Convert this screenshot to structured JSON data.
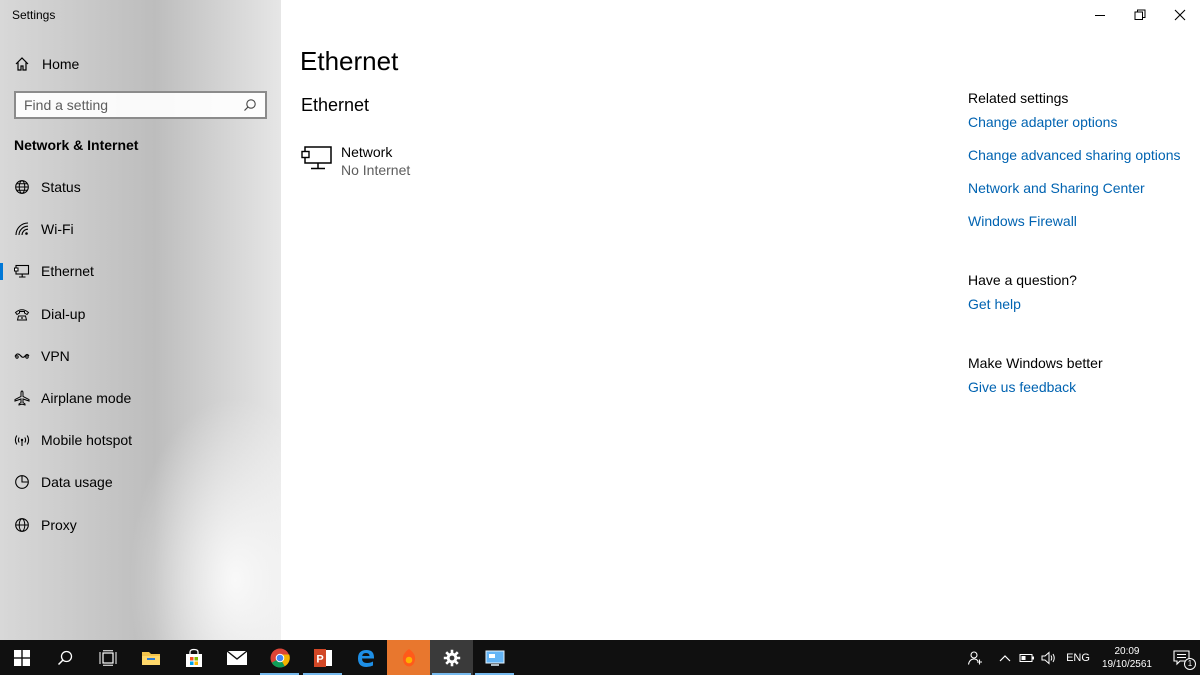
{
  "window": {
    "title": "Settings",
    "controls": [
      "minimize-icon",
      "restore-icon",
      "close-icon"
    ]
  },
  "sidebar": {
    "home_label": "Home",
    "search_placeholder": "Find a setting",
    "section_title": "Network & Internet",
    "items": [
      {
        "label": "Status",
        "icon": "status-globe-icon",
        "active": false
      },
      {
        "label": "Wi-Fi",
        "icon": "wifi-icon",
        "active": false
      },
      {
        "label": "Ethernet",
        "icon": "ethernet-icon",
        "active": true
      },
      {
        "label": "Dial-up",
        "icon": "dialup-icon",
        "active": false
      },
      {
        "label": "VPN",
        "icon": "vpn-icon",
        "active": false
      },
      {
        "label": "Airplane mode",
        "icon": "airplane-icon",
        "active": false
      },
      {
        "label": "Mobile hotspot",
        "icon": "hotspot-icon",
        "active": false
      },
      {
        "label": "Data usage",
        "icon": "data-usage-icon",
        "active": false
      },
      {
        "label": "Proxy",
        "icon": "proxy-globe-icon",
        "active": false
      }
    ]
  },
  "main": {
    "page_title": "Ethernet",
    "section_title": "Ethernet",
    "network": {
      "name": "Network",
      "status": "No Internet",
      "icon": "wired-network-icon"
    }
  },
  "related": {
    "related_settings_header": "Related settings",
    "links": [
      "Change adapter options",
      "Change advanced sharing options",
      "Network and Sharing Center",
      "Windows Firewall"
    ],
    "question_header": "Have a question?",
    "get_help": "Get help",
    "better_header": "Make Windows better",
    "feedback": "Give us feedback"
  },
  "taskbar": {
    "apps": [
      {
        "name": "start-icon"
      },
      {
        "name": "search-icon"
      },
      {
        "name": "task-view-icon"
      },
      {
        "name": "file-explorer-icon"
      },
      {
        "name": "store-icon"
      },
      {
        "name": "mail-icon"
      },
      {
        "name": "chrome-icon"
      },
      {
        "name": "powerpoint-icon"
      },
      {
        "name": "edge-icon"
      },
      {
        "name": "orange-app-icon"
      },
      {
        "name": "settings-gear-icon"
      },
      {
        "name": "remote-desktop-icon"
      }
    ],
    "tray": {
      "language": "ENG",
      "time": "20:09",
      "date": "19/10/2561",
      "notification_count": "1"
    }
  },
  "colors": {
    "accent": "#0078d7",
    "link": "#0063b1",
    "taskbar": "#101010",
    "highlight_app": "#e8772e"
  }
}
